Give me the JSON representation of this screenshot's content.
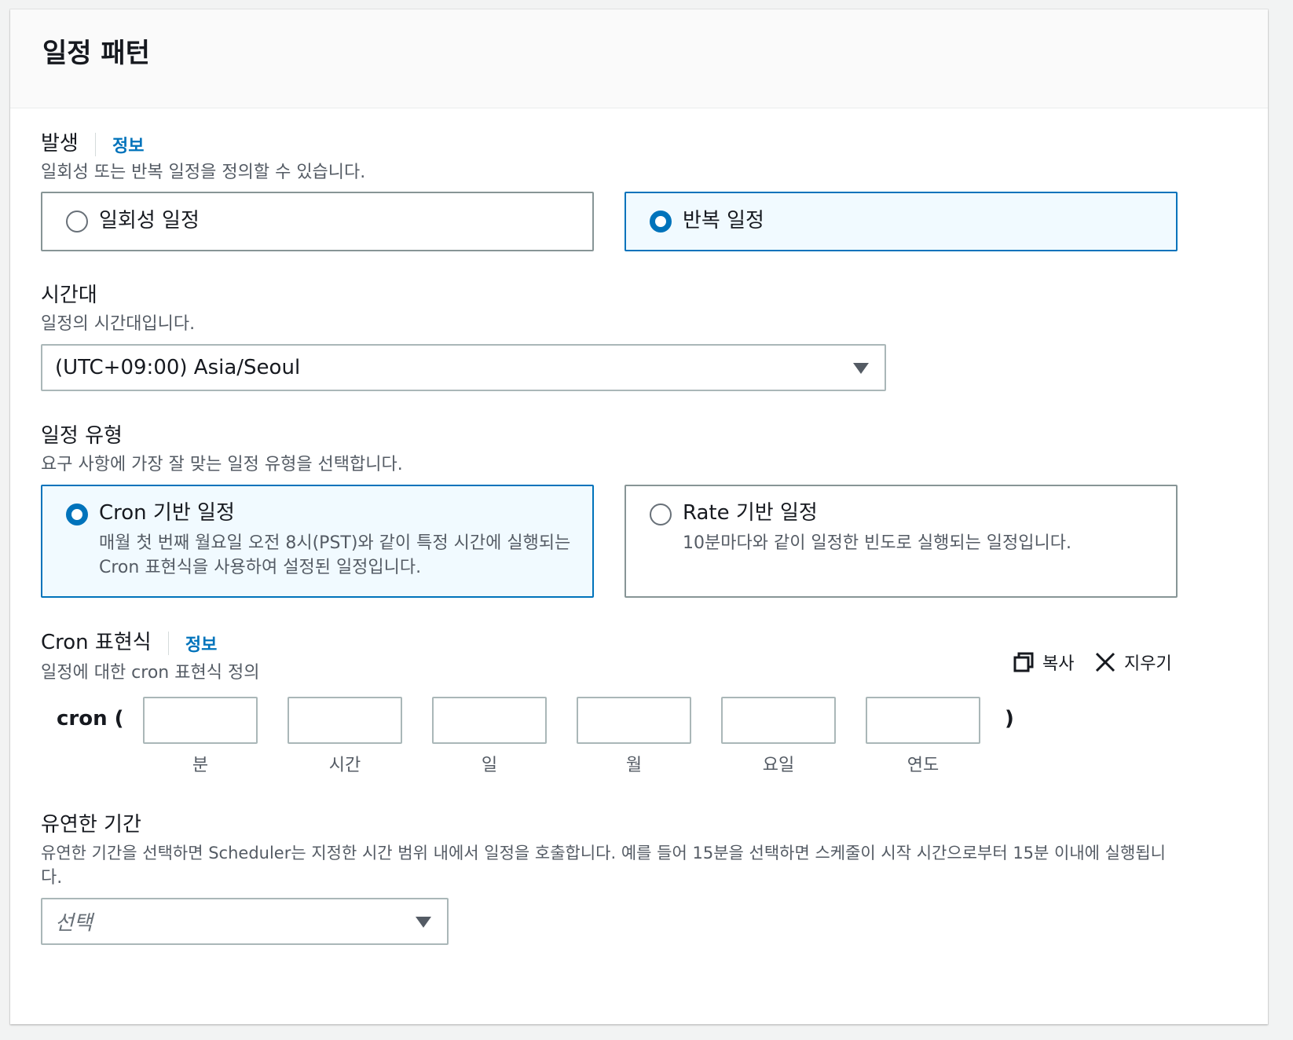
{
  "panel": {
    "title": "일정 패턴"
  },
  "occurrence": {
    "label": "발생",
    "info": "정보",
    "description": "일회성 또는 반복 일정을 정의할 수 있습니다.",
    "options": [
      {
        "label": "일회성 일정",
        "selected": false
      },
      {
        "label": "반복 일정",
        "selected": true
      }
    ]
  },
  "timezone": {
    "label": "시간대",
    "description": "일정의 시간대입니다.",
    "value": "(UTC+09:00) Asia/Seoul"
  },
  "schedule_type": {
    "label": "일정 유형",
    "description": "요구 사항에 가장 잘 맞는 일정 유형을 선택합니다.",
    "options": [
      {
        "label": "Cron 기반 일정",
        "description_line1": "매월 첫 번째 월요일 오전 8시(PST)와 같이 특정 시간에 실행되는",
        "description_line2": "Cron 표현식을 사용하여 설정된 일정입니다.",
        "selected": true
      },
      {
        "label": "Rate 기반 일정",
        "description_line1": "10분마다와 같이 일정한 빈도로 실행되는 일정입니다.",
        "selected": false
      }
    ]
  },
  "cron_expression": {
    "label": "Cron 표현식",
    "info": "정보",
    "description": "일정에 대한 cron 표현식 정의",
    "copy_label": "복사",
    "clear_label": "지우기",
    "prefix": "cron (",
    "suffix": ")",
    "fields": [
      {
        "caption": "분",
        "value": ""
      },
      {
        "caption": "시간",
        "value": ""
      },
      {
        "caption": "일",
        "value": ""
      },
      {
        "caption": "월",
        "value": ""
      },
      {
        "caption": "요일",
        "value": ""
      },
      {
        "caption": "연도",
        "value": ""
      }
    ]
  },
  "flexible_window": {
    "label": "유연한 기간",
    "description_line1": "유연한 기간을 선택하면 Scheduler는 지정한 시간 범위 내에서 일정을 호출합니다. 예를 들어 15분을 선택하면 스케줄이 시작 시간으로부터 15분 이내에 실행됩니",
    "description_line2": "다.",
    "placeholder": "선택"
  },
  "colors": {
    "accent": "#0073bb",
    "selected_bg": "#f1faff",
    "border": "#879596",
    "text": "#16191f",
    "secondary_text": "#545b64"
  },
  "icons": {
    "copy": "copy-icon",
    "clear": "close-icon",
    "dropdown": "caret-down-icon"
  }
}
